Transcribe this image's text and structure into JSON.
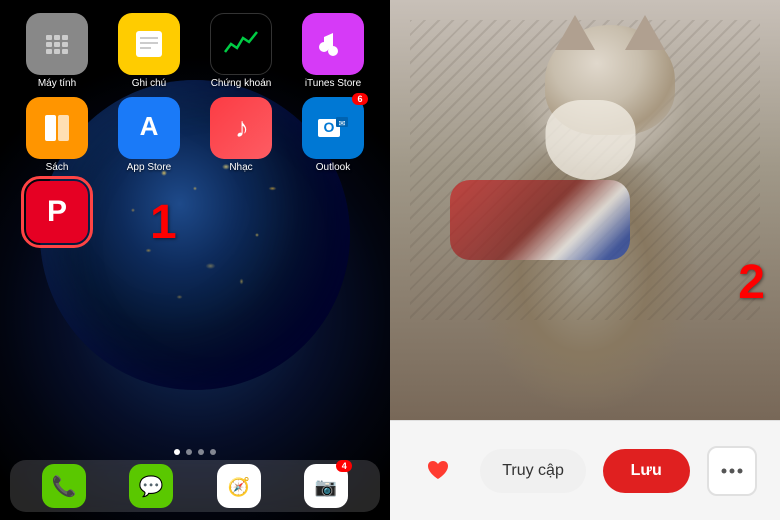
{
  "left": {
    "apps_row1": [
      {
        "id": "calculator",
        "label": "Máy tính",
        "icon": "🖩",
        "badge": null
      },
      {
        "id": "notes",
        "label": "Ghi chú",
        "icon": "📝",
        "badge": null
      },
      {
        "id": "stocks",
        "label": "Chứng khoán",
        "icon": "📈",
        "badge": null
      },
      {
        "id": "itunes",
        "label": "iTunes Store",
        "icon": "★",
        "badge": null
      }
    ],
    "apps_row2": [
      {
        "id": "books",
        "label": "Sách",
        "icon": "📚",
        "badge": null
      },
      {
        "id": "appstore",
        "label": "App Store",
        "icon": "A",
        "badge": null
      },
      {
        "id": "music",
        "label": "Nhạc",
        "icon": "♪",
        "badge": null
      },
      {
        "id": "outlook",
        "label": "Outlook",
        "icon": "✉",
        "badge": "6"
      }
    ],
    "apps_row3": [
      {
        "id": "pinterest",
        "label": "Pinterest",
        "icon": "P",
        "badge": null
      }
    ],
    "number1": "1",
    "dock_badge": "4"
  },
  "right": {
    "number2": "2",
    "buttons": {
      "truy_cap": "Truy cập",
      "luu": "Lưu",
      "more": "···"
    }
  }
}
